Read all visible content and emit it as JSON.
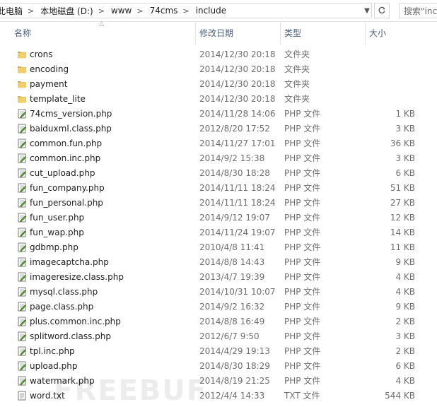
{
  "address": {
    "crumbs": [
      "此电脑",
      "本地磁盘 (D:)",
      "www",
      "74cms",
      "include"
    ],
    "search_placeholder": "搜索\"inc"
  },
  "columns": {
    "name": "名称",
    "date": "修改日期",
    "type": "类型",
    "size": "大小"
  },
  "colors": {
    "folder": "#e8c25b",
    "php_icon": "#4a8a2a",
    "header_text": "#4c607a"
  },
  "files": [
    {
      "name": "crons",
      "date": "2014/12/30 20:18",
      "type": "文件夹",
      "size": "",
      "kind": "folder"
    },
    {
      "name": "encoding",
      "date": "2014/12/30 20:18",
      "type": "文件夹",
      "size": "",
      "kind": "folder"
    },
    {
      "name": "payment",
      "date": "2014/12/30 20:18",
      "type": "文件夹",
      "size": "",
      "kind": "folder"
    },
    {
      "name": "template_lite",
      "date": "2014/12/30 20:18",
      "type": "文件夹",
      "size": "",
      "kind": "folder"
    },
    {
      "name": "74cms_version.php",
      "date": "2014/11/28 14:06",
      "type": "PHP 文件",
      "size": "1 KB",
      "kind": "php"
    },
    {
      "name": "baiduxml.class.php",
      "date": "2012/8/20 17:52",
      "type": "PHP 文件",
      "size": "3 KB",
      "kind": "php"
    },
    {
      "name": "common.fun.php",
      "date": "2014/11/27 17:01",
      "type": "PHP 文件",
      "size": "36 KB",
      "kind": "php"
    },
    {
      "name": "common.inc.php",
      "date": "2014/9/2 15:38",
      "type": "PHP 文件",
      "size": "3 KB",
      "kind": "php"
    },
    {
      "name": "cut_upload.php",
      "date": "2014/8/30 18:28",
      "type": "PHP 文件",
      "size": "6 KB",
      "kind": "php"
    },
    {
      "name": "fun_company.php",
      "date": "2014/11/11 18:24",
      "type": "PHP 文件",
      "size": "51 KB",
      "kind": "php"
    },
    {
      "name": "fun_personal.php",
      "date": "2014/11/11 18:24",
      "type": "PHP 文件",
      "size": "27 KB",
      "kind": "php"
    },
    {
      "name": "fun_user.php",
      "date": "2014/9/12 19:07",
      "type": "PHP 文件",
      "size": "12 KB",
      "kind": "php"
    },
    {
      "name": "fun_wap.php",
      "date": "2014/11/24 19:07",
      "type": "PHP 文件",
      "size": "14 KB",
      "kind": "php"
    },
    {
      "name": "gdbmp.php",
      "date": "2010/4/8 11:41",
      "type": "PHP 文件",
      "size": "11 KB",
      "kind": "php"
    },
    {
      "name": "imagecaptcha.php",
      "date": "2014/8/8 14:43",
      "type": "PHP 文件",
      "size": "9 KB",
      "kind": "php"
    },
    {
      "name": "imageresize.class.php",
      "date": "2013/4/7 19:39",
      "type": "PHP 文件",
      "size": "4 KB",
      "kind": "php"
    },
    {
      "name": "mysql.class.php",
      "date": "2014/10/31 10:07",
      "type": "PHP 文件",
      "size": "4 KB",
      "kind": "php"
    },
    {
      "name": "page.class.php",
      "date": "2014/9/2 16:32",
      "type": "PHP 文件",
      "size": "9 KB",
      "kind": "php"
    },
    {
      "name": "plus.common.inc.php",
      "date": "2014/8/8 16:49",
      "type": "PHP 文件",
      "size": "2 KB",
      "kind": "php"
    },
    {
      "name": "splitword.class.php",
      "date": "2012/6/7 9:50",
      "type": "PHP 文件",
      "size": "3 KB",
      "kind": "php"
    },
    {
      "name": "tpl.inc.php",
      "date": "2014/4/29 19:13",
      "type": "PHP 文件",
      "size": "2 KB",
      "kind": "php"
    },
    {
      "name": "upload.php",
      "date": "2014/8/30 18:29",
      "type": "PHP 文件",
      "size": "6 KB",
      "kind": "php"
    },
    {
      "name": "watermark.php",
      "date": "2014/8/19 21:25",
      "type": "PHP 文件",
      "size": "4 KB",
      "kind": "php"
    },
    {
      "name": "word.txt",
      "date": "2012/4/4 14:33",
      "type": "TXT 文件",
      "size": "544 KB",
      "kind": "txt"
    }
  ],
  "watermark": "FREEBUF"
}
